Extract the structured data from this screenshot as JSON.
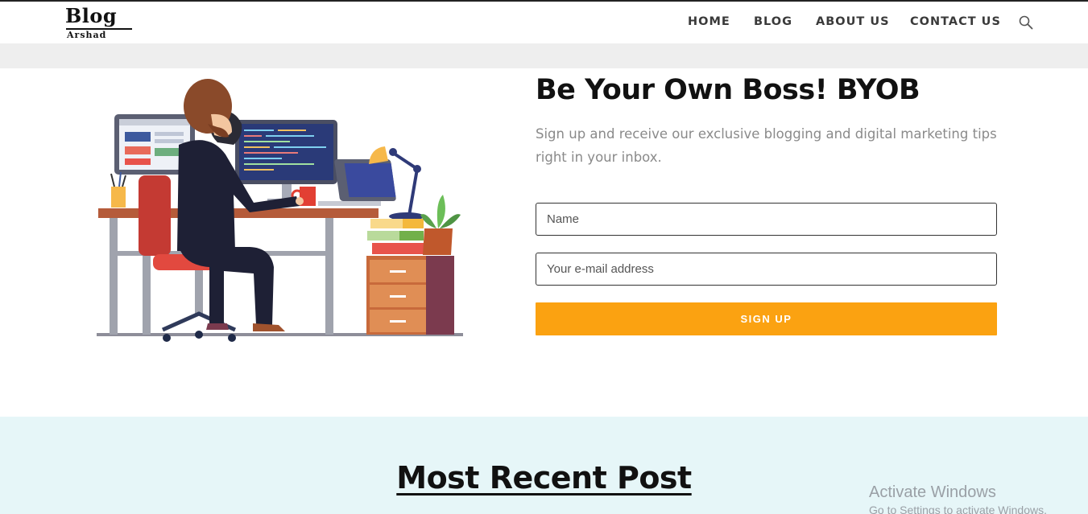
{
  "logo": {
    "main": "Blog",
    "sub": "Arshad"
  },
  "nav": {
    "items": [
      "HOME",
      "BLOG",
      "ABOUT US",
      "CONTACT US"
    ],
    "search_icon": "search-icon"
  },
  "hero": {
    "title": "Be Your Own Boss! BYOB",
    "text": "Sign up and receive our exclusive blogging and digital marketing tips right in your inbox.",
    "name_placeholder": "Name",
    "email_placeholder": "Your e-mail address",
    "button_label": "SIGN UP",
    "accent_color": "#fba211"
  },
  "recent": {
    "title": "Most Recent Post"
  },
  "watermark": {
    "title": "Activate Windows",
    "subtitle": "Go to Settings to activate Windows."
  }
}
